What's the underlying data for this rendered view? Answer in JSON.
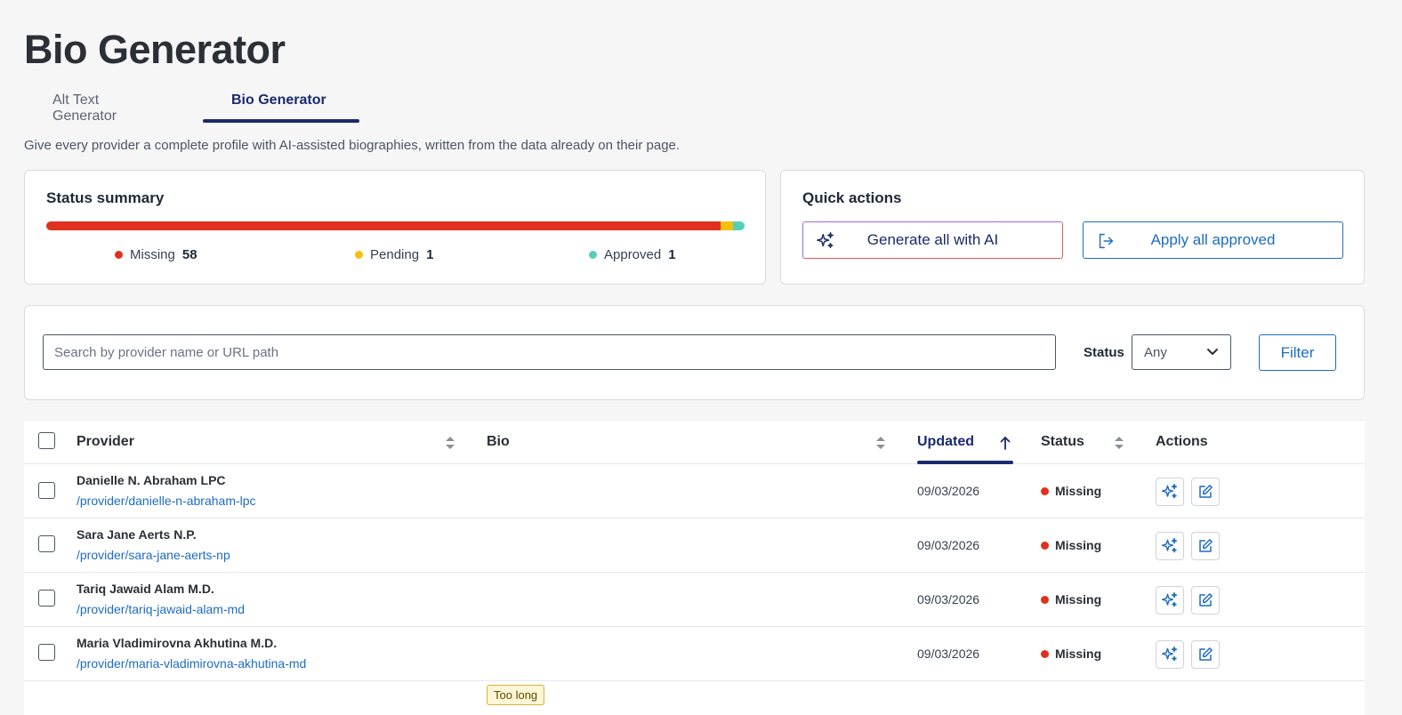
{
  "page": {
    "title": "Bio Generator",
    "intro": "Give every provider a complete profile with AI-assisted biographies, written from the data already on their page."
  },
  "tabs": [
    {
      "label": "Alt Text Generator",
      "active": false
    },
    {
      "label": "Bio Generator",
      "active": true
    }
  ],
  "status_summary": {
    "title": "Status summary",
    "items": [
      {
        "label": "Missing",
        "count": "58",
        "color": "#e0301e"
      },
      {
        "label": "Pending",
        "count": "1",
        "color": "#f5bf10"
      },
      {
        "label": "Approved",
        "count": "1",
        "color": "#55cfb8"
      }
    ]
  },
  "quick_actions": {
    "title": "Quick actions",
    "generate_label": "Generate all with AI",
    "apply_label": "Apply all approved"
  },
  "filter": {
    "search_placeholder": "Search by provider name or URL path",
    "status_label": "Status",
    "status_value": "Any",
    "filter_label": "Filter"
  },
  "table": {
    "columns": {
      "provider": "Provider",
      "bio": "Bio",
      "updated": "Updated",
      "status": "Status",
      "actions": "Actions"
    },
    "sorted_by": "Updated",
    "rows": [
      {
        "name": "Danielle N. Abraham LPC",
        "url": "/provider/danielle-n-abraham-lpc",
        "updated": "09/03/2026",
        "status": "Missing"
      },
      {
        "name": "Sara Jane Aerts N.P.",
        "url": "/provider/sara-jane-aerts-np",
        "updated": "09/03/2026",
        "status": "Missing"
      },
      {
        "name": "Tariq Jawaid Alam M.D.",
        "url": "/provider/tariq-jawaid-alam-md",
        "updated": "09/03/2026",
        "status": "Missing"
      },
      {
        "name": "Maria Vladimirovna Akhutina M.D.",
        "url": "/provider/maria-vladimirovna-akhutina-md",
        "updated": "09/03/2026",
        "status": "Missing"
      }
    ],
    "partial_row_badge": "Too long"
  },
  "icons": {
    "generate": "sparkles-icon",
    "apply": "sign-out-icon",
    "select": "chevron-down-icon",
    "sort": "sort-icon",
    "sort_asc": "arrow-up-icon",
    "row_generate": "sparkles-icon",
    "row_edit": "edit-icon"
  },
  "colors": {
    "accent": "#1a2a6c",
    "link": "#1e6cc0",
    "missing": "#e0301e",
    "pending": "#f5bf10",
    "approved": "#55cfb8"
  }
}
